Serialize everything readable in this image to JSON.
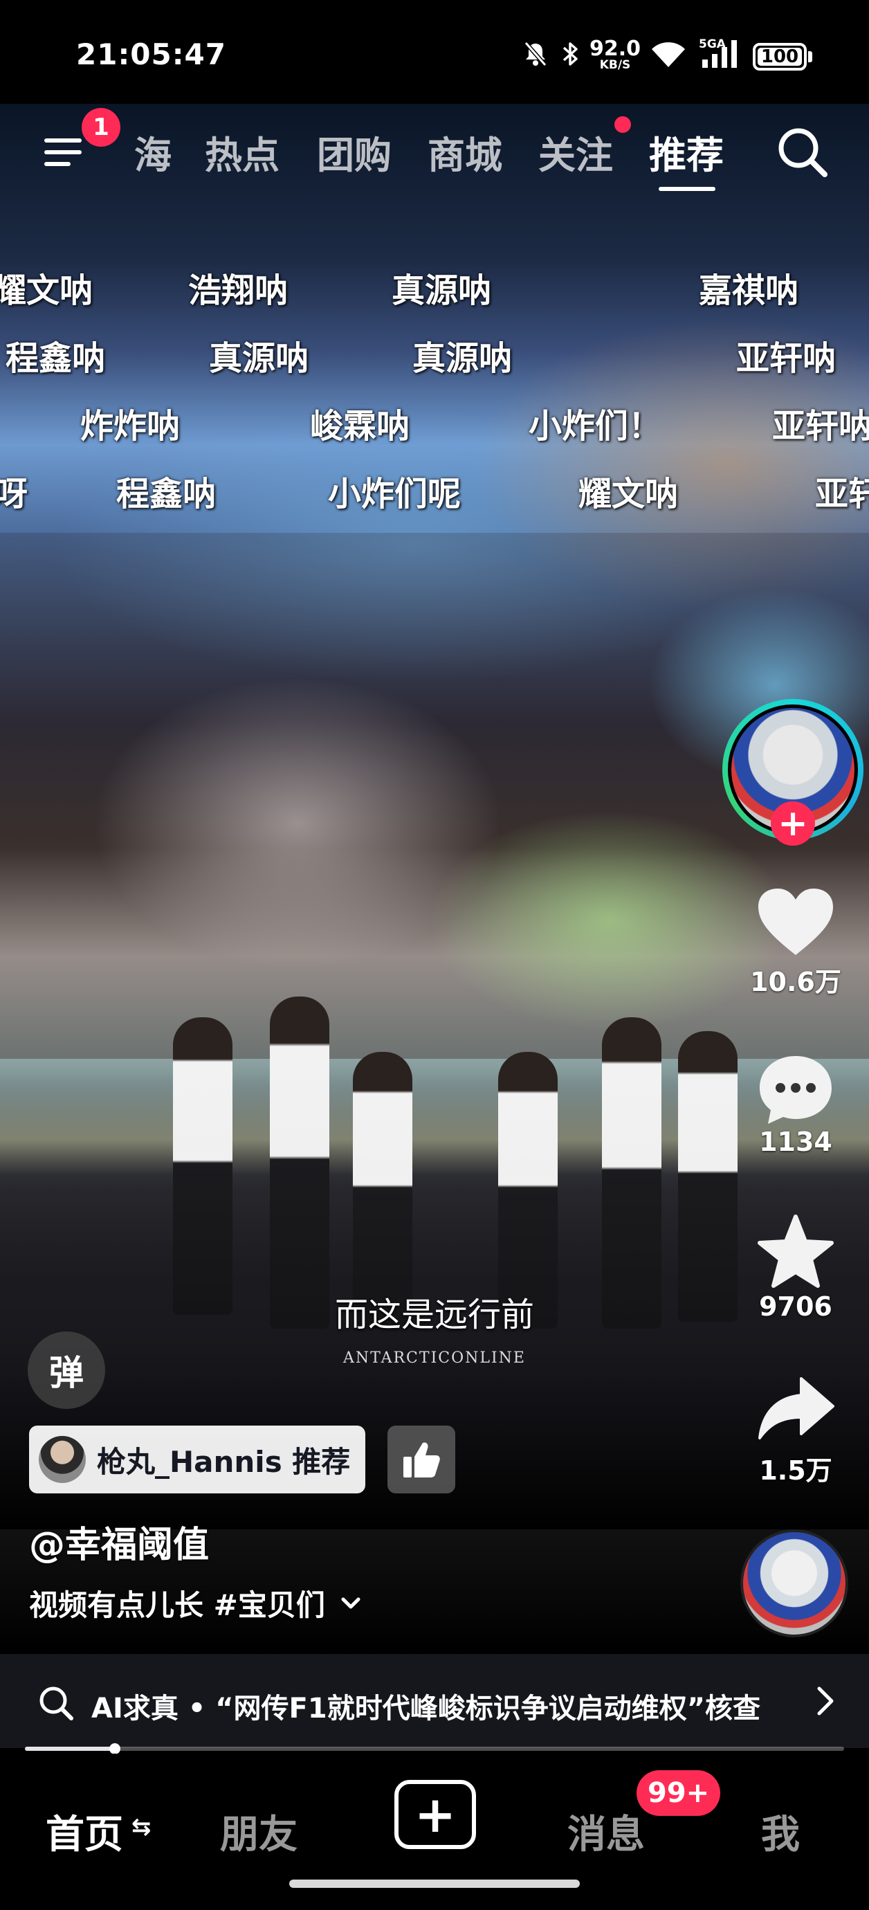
{
  "status_bar": {
    "time": "21:05:47",
    "net_speed_value": "92.0",
    "net_speed_unit": "KB/S",
    "signal_label": "5GA",
    "battery": "100",
    "battery_level": 1.0
  },
  "top_nav": {
    "menu_badge": "1",
    "tabs": [
      "海",
      "热点",
      "团购",
      "商城",
      "关注",
      "推荐"
    ],
    "active_tab": "推荐"
  },
  "danmaku": [
    "耀文呐",
    "浩翔呐",
    "真源呐",
    "嘉祺呐",
    "程鑫呐",
    "真源呐",
    "真源呐",
    "亚轩呐",
    "炸炸呐",
    "峻霖呐",
    "小炸们！",
    "亚轩呐",
    "呀",
    "程鑫呐",
    "小炸们呢",
    "耀文呐",
    "亚轩"
  ],
  "video": {
    "subtitle": "而这是远行前",
    "watermark": "ANTARCTICONLINE"
  },
  "right_rail": {
    "likes": "10.6万",
    "comments": "1134",
    "favorites": "9706",
    "shares": "1.5万"
  },
  "info": {
    "danmaku_toggle": "弹",
    "recommender": "枪丸_Hannis 推荐",
    "author": "@幸福阈值",
    "caption": "视频有点儿长 #宝贝们"
  },
  "ai_bar": {
    "text": "AI求真 • “网传F1就时代峰峻标识争议启动维权”核查"
  },
  "progress": {
    "fraction": 0.11
  },
  "bottom_nav": {
    "home": "首页",
    "home_switch": "⇆",
    "friends": "朋友",
    "add": "+",
    "messages": "消息",
    "messages_badge": "99+",
    "me": "我"
  },
  "colors": {
    "accent_red": "#fe2c55",
    "ring_cyan": "#19d8d8",
    "bar_bg": "#16171c"
  }
}
